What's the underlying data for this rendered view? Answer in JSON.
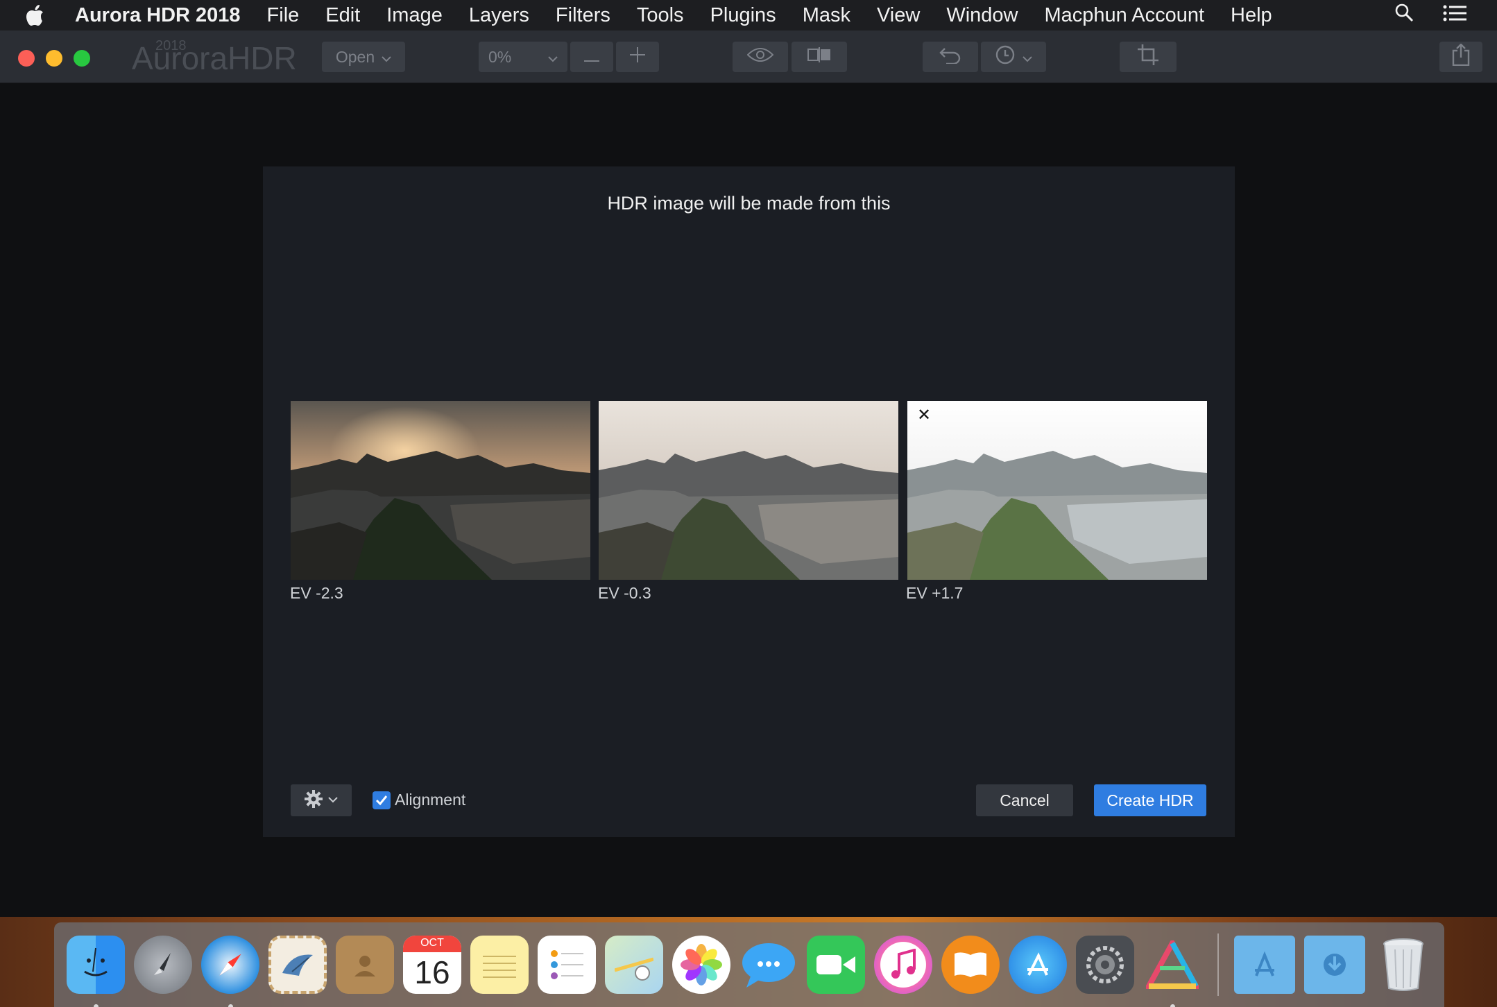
{
  "menubar": {
    "app_name": "Aurora HDR 2018",
    "items": [
      "File",
      "Edit",
      "Image",
      "Layers",
      "Filters",
      "Tools",
      "Plugins",
      "Mask",
      "View",
      "Window",
      "Macphun Account",
      "Help"
    ]
  },
  "toolbar": {
    "logo_year": "2018",
    "logo_text": "AuroraHDR",
    "open_label": "Open",
    "zoom_value": "0%"
  },
  "dialog": {
    "title": "HDR image will be made from this",
    "images": [
      {
        "label": "EV -2.3"
      },
      {
        "label": "EV -0.3"
      },
      {
        "label": "EV +1.7"
      }
    ],
    "remove_symbol": "✕",
    "alignment_label": "Alignment",
    "alignment_checked": true,
    "cancel_label": "Cancel",
    "create_label": "Create HDR"
  },
  "dock": {
    "calendar_month": "OCT",
    "calendar_day": "16",
    "apps": [
      "finder-icon",
      "launchpad-icon",
      "safari-icon",
      "mail-icon",
      "contacts-icon",
      "calendar-icon",
      "notes-icon",
      "reminders-icon",
      "maps-icon",
      "photos-icon",
      "messages-icon",
      "facetime-icon",
      "itunes-icon",
      "ibooks-icon",
      "app-store-icon",
      "system-preferences-icon",
      "aurora-hdr-icon",
      "applications-folder-icon",
      "downloads-folder-icon",
      "trash-icon"
    ]
  },
  "colors": {
    "accent": "#2f7de1",
    "dialog_bg": "#1b1e24",
    "toolbar_bg": "#2b2e34"
  }
}
